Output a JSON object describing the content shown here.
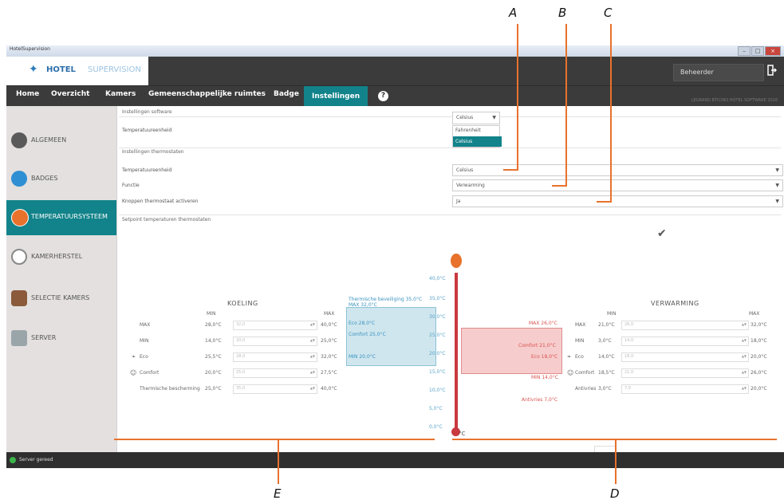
{
  "callouts": {
    "a": "A",
    "b": "B",
    "c": "C",
    "d": "D",
    "e": "E"
  },
  "window": {
    "title": "HotelSupervision",
    "controls": [
      "–",
      "□",
      "×"
    ]
  },
  "header": {
    "logo_bold": "HOTEL",
    "logo_light": "SUPERVISION",
    "user": "Beheerder",
    "subtitle": "LEGRAND BTICINO HOTEL SOFTWARE 2016"
  },
  "tabs": [
    "Home",
    "Overzicht",
    "Kamers",
    "Gemeenschappelijke ruimtes",
    "Badge",
    "Instellingen"
  ],
  "help_glyph": "?",
  "sidebar": {
    "items": [
      {
        "label": "ALGEMEEN",
        "icon": "gear-icon",
        "color": "#5a5a5a"
      },
      {
        "label": "BADGES",
        "icon": "badge-icon",
        "color": "#2f8fd3"
      },
      {
        "label": "TEMPERATUURSYSTEEM",
        "icon": "thermometer-icon",
        "color": "#e8722c"
      },
      {
        "label": "KAMERHERSTEL",
        "icon": "reset-icon",
        "color": "#888888"
      },
      {
        "label": "SELECTIE KAMERS",
        "icon": "rooms-icon",
        "color": "#8a5a3a"
      },
      {
        "label": "SERVER",
        "icon": "server-icon",
        "color": "#9aa5aa"
      }
    ]
  },
  "software": {
    "section": "Instellingen software",
    "unit_label": "Temperatuureenheid",
    "unit_value": "Celsius",
    "options": [
      "Fahrenheit",
      "Celsius"
    ]
  },
  "thermostats": {
    "section": "Instellingen thermostaten",
    "rows": [
      {
        "label": "Temperatuureenheid",
        "value": "Celsius"
      },
      {
        "label": "Functie",
        "value": "Verwarming"
      },
      {
        "label": "Knoppen thermostaat activeren",
        "value": "Ja"
      }
    ]
  },
  "setpoint": {
    "section": "Setpoint temperaturen thermostaten",
    "check": "✔",
    "cooling": {
      "title": "KOELING",
      "min_hdr": "MIN",
      "max_hdr": "MAX",
      "rows": [
        {
          "label": "MAX",
          "min": "28,0°C",
          "val": "32,0",
          "max": "40,0°C"
        },
        {
          "label": "MIN",
          "min": "14,0°C",
          "val": "20,0",
          "max": "25,0°C"
        },
        {
          "label": "Eco",
          "min": "25,5°C",
          "val": "28,0",
          "max": "32,0°C"
        },
        {
          "label": "Comfort",
          "min": "20,0°C",
          "val": "25,0",
          "max": "27,5°C"
        },
        {
          "label": "Thermische bescherming",
          "min": "25,0°C",
          "val": "35,0",
          "max": "40,0°C"
        }
      ]
    },
    "heating": {
      "title": "VERWARMING",
      "min_hdr": "MIN",
      "max_hdr": "MAX",
      "rows": [
        {
          "label": "MAX",
          "min": "21,0°C",
          "val": "26,0",
          "max": "32,0°C"
        },
        {
          "label": "MIN",
          "min": "3,0°C",
          "val": "14,0",
          "max": "18,0°C"
        },
        {
          "label": "Eco",
          "min": "14,0°C",
          "val": "18,0",
          "max": "20,0°C"
        },
        {
          "label": "Comfort",
          "min": "18,5°C",
          "val": "21,0",
          "max": "26,0°C"
        },
        {
          "label": "Antivries",
          "min": "3,0°C",
          "val": "7,0",
          "max": "20,0°C"
        }
      ]
    },
    "scale": [
      "40,0°C",
      "35,0°C",
      "30,0°C",
      "25,0°C",
      "20,0°C",
      "15,0°C",
      "10,0°C",
      "5,0°C",
      "0,0°C"
    ],
    "unit": "°C",
    "blue_labels": {
      "thermal": "Thermische beveiliging 35,0°C",
      "max": "MAX 32,0°C",
      "eco": "Eco 28,0°C",
      "comfort": "Comfort 25,0°C",
      "min": "MIN 20,0°C"
    },
    "red_labels": {
      "max": "MAX 26,0°C",
      "comfort": "Comfort 21,0°C",
      "eco": "Eco 18,0°C",
      "min": "MIN 14,0°C",
      "antifreeze": "Antivries 7,0°C"
    }
  },
  "status": {
    "text": "Server gereed"
  }
}
